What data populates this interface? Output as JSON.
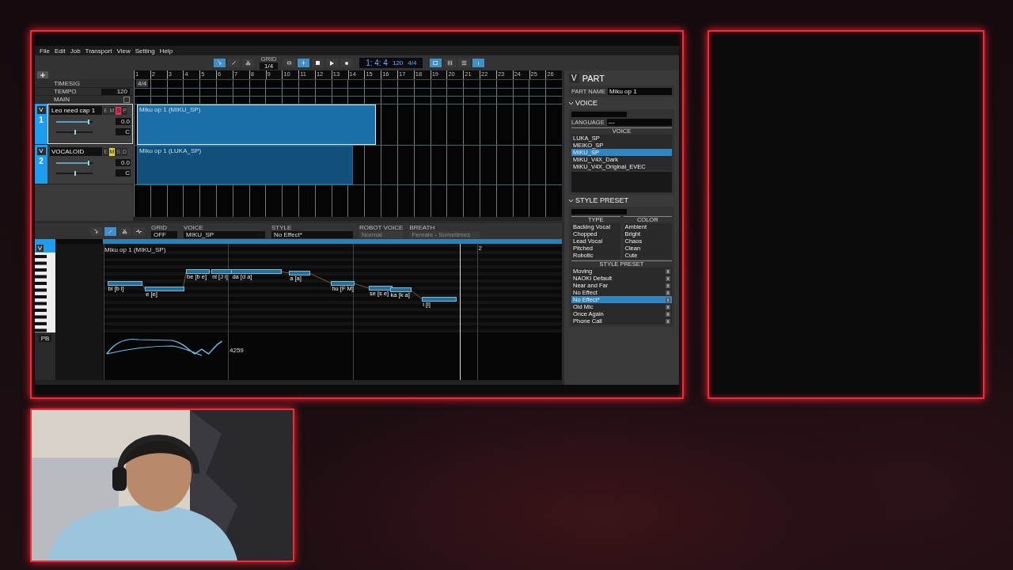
{
  "menu": [
    "File",
    "Edit",
    "Job",
    "Transport",
    "View",
    "Setting",
    "Help"
  ],
  "toolbar": {
    "grid_label": "GRID",
    "grid_value": "1/4",
    "position": "1: 4: 4",
    "tempo": "120",
    "timesig": "4/4"
  },
  "global_tracks": {
    "timesig_label": "TIMESIG",
    "tempo_label": "TEMPO",
    "tempo_value": "120",
    "main_label": "MAIN",
    "main_checked": false,
    "timesig_value": "4/4"
  },
  "ruler": [
    "1",
    "2",
    "3",
    "4",
    "5",
    "6",
    "7",
    "8",
    "9",
    "10",
    "11",
    "12",
    "13",
    "14",
    "15",
    "16",
    "17",
    "18",
    "19",
    "20",
    "21",
    "22",
    "23",
    "24",
    "25",
    "26"
  ],
  "tracks": [
    {
      "badge": "V",
      "number": "1",
      "name": "Leo need cap 1",
      "selected": true,
      "volume": {
        "level": 0.88,
        "reading": "0.0"
      },
      "pan": {
        "level": 0.5,
        "reading": "C"
      },
      "buttons": [
        {
          "label": "E",
          "kind": "edit",
          "on": false
        },
        {
          "label": "M",
          "kind": "mute",
          "on": false
        },
        {
          "label": "S",
          "kind": "solo",
          "on": true
        },
        {
          "label": "P",
          "kind": "plain",
          "on": false
        }
      ],
      "part": {
        "name": "Miku op 1 (MIKU_SP)",
        "selected": true
      }
    },
    {
      "badge": "V",
      "number": "2",
      "name": "VOCALOID",
      "selected": false,
      "volume": {
        "level": 0.88,
        "reading": "0.0"
      },
      "pan": {
        "level": 0.5,
        "reading": "C"
      },
      "buttons": [
        {
          "label": "E",
          "kind": "edit",
          "on": false
        },
        {
          "label": "M",
          "kind": "mute",
          "on": true
        },
        {
          "label": "S",
          "kind": "solo",
          "on": false
        },
        {
          "label": "D",
          "kind": "plain",
          "on": false
        }
      ],
      "part": {
        "name": "Miku op 1 (LUKA_SP)",
        "selected": false
      }
    }
  ],
  "editor": {
    "grid_label": "GRID",
    "grid_value": "OFF",
    "voice_label": "VOICE",
    "voice_value": "MIKU_SP",
    "style_label": "STYLE",
    "style_value": "No Effect*",
    "robot_label": "ROBOT VOICE",
    "robot_value": "Normal",
    "robot_disabled": true,
    "breath_label": "BREATH",
    "breath_value": "Female - Sometimes",
    "breath_disabled": true,
    "badge": "V",
    "part_label": "Miku op 1 (MIKU_SP)",
    "bar_marker": "2",
    "notes": [
      {
        "lyric": "bi [b i]"
      },
      {
        "lyric": "e [e]"
      },
      {
        "lyric": "be [b e]"
      },
      {
        "lyric": "ni [J i]"
      },
      {
        "lyric": "da [d a]"
      },
      {
        "lyric": "a [a]"
      },
      {
        "lyric": "hu [F M]"
      },
      {
        "lyric": "se [s e]"
      },
      {
        "lyric": "ka [k a]"
      },
      {
        "lyric": "i [i]"
      }
    ],
    "parameter": "PB",
    "parameter_value": "4259"
  },
  "part_panel": {
    "badge": "V",
    "title": "PART",
    "part_name_label": "PART NAME",
    "part_name": "Miku op 1",
    "voice": {
      "title": "VOICE",
      "language_label": "LANGUAGE",
      "language": "---",
      "list_title": "VOICE",
      "items": [
        {
          "label": "LUKA_SP",
          "selected": false
        },
        {
          "label": "MEIKO_SP",
          "selected": false
        },
        {
          "label": "MIKU_SP",
          "selected": true
        },
        {
          "label": "MIKU_V4X_Dark",
          "selected": false
        },
        {
          "label": "MIKU_V4X_Original_EVEC",
          "selected": false
        }
      ]
    },
    "style": {
      "title": "STYLE PRESET",
      "type_title": "TYPE",
      "types": [
        "Backing Vocal",
        "Chopped",
        "Lead Vocal",
        "Pitched",
        "Robotic"
      ],
      "color_title": "COLOR",
      "colors": [
        "Ambient",
        "Bright",
        "Chaos",
        "Clean",
        "Cute"
      ],
      "preset_title": "STYLE PRESET",
      "presets": [
        {
          "label": "Moving",
          "selected": false
        },
        {
          "label": "NAOKI Default",
          "selected": false
        },
        {
          "label": "Near and Far",
          "selected": false
        },
        {
          "label": "No Effect",
          "selected": false
        },
        {
          "label": "No Effect*",
          "selected": true
        },
        {
          "label": "Old Mic",
          "selected": false
        },
        {
          "label": "Once Again",
          "selected": false
        },
        {
          "label": "Phone Call",
          "selected": false
        }
      ]
    }
  },
  "webcam": {
    "kind": "picture"
  }
}
